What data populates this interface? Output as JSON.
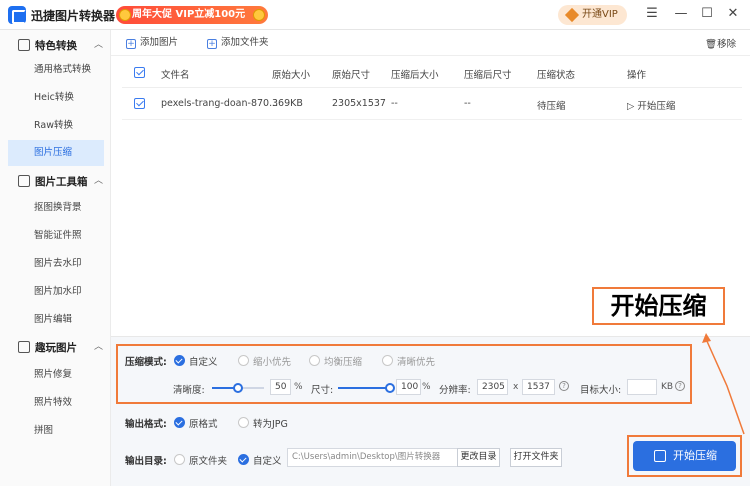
{
  "app": {
    "title": "迅捷图片转换器",
    "promo": "周年大促 VIP立减100元",
    "vip_button": "开通VIP"
  },
  "window": {
    "minimize": "—",
    "restore": "☐",
    "close": "✕",
    "menu": "☰"
  },
  "sidebar": {
    "sections": [
      {
        "label": "特色转换",
        "items": [
          "通用格式转换",
          "Heic转换",
          "Raw转换",
          "图片压缩"
        ]
      },
      {
        "label": "图片工具箱",
        "items": [
          "抠图换背景",
          "智能证件照",
          "图片去水印",
          "图片加水印",
          "图片编辑"
        ]
      },
      {
        "label": "趣玩图片",
        "items": [
          "照片修复",
          "照片特效",
          "拼图"
        ]
      }
    ],
    "active_item": "图片压缩"
  },
  "toolbar": {
    "add_image": "添加图片",
    "add_folder": "添加文件夹",
    "remove": "移除"
  },
  "table": {
    "headers": [
      "文件名",
      "原始大小",
      "原始尺寸",
      "压缩后大小",
      "压缩后尺寸",
      "压缩状态",
      "操作"
    ],
    "rows": [
      {
        "name": "pexels-trang-doan-870...",
        "size": "369KB",
        "dims": "2305x1537",
        "csize": "--",
        "cdims": "--",
        "status": "待压缩",
        "action": "开始压缩"
      }
    ]
  },
  "settings": {
    "mode_label": "压缩模式:",
    "modes": [
      "自定义",
      "缩小优先",
      "均衡压缩",
      "清晰优先"
    ],
    "mode_selected": "自定义",
    "clarity_label": "清晰度:",
    "clarity_value": "50",
    "clarity_unit": "%",
    "clarity_fraction": 0.5,
    "size_label": "尺寸:",
    "size_value": "100",
    "size_unit": "%",
    "size_fraction": 1.0,
    "resolution_label": "分辨率:",
    "res_w": "2305",
    "res_x": "x",
    "res_h": "1537",
    "target_label": "目标大小:",
    "target_value": "",
    "target_unit": "KB",
    "format_label": "输出格式:",
    "formats": [
      "原格式",
      "转为JPG"
    ],
    "format_selected": "原格式",
    "dir_label": "输出目录:",
    "dirs": [
      "原文件夹",
      "自定义"
    ],
    "dir_selected": "自定义",
    "dir_path": "C:\\Users\\admin\\Desktop\\图片转换器",
    "change_dir": "更改目录",
    "open_folder": "打开文件夹"
  },
  "start_button": "开始压缩",
  "callout": "开始压缩",
  "colors": {
    "accent": "#2b6fe0",
    "annotation": "#f07a3a",
    "promo": "#ff4b3a"
  }
}
